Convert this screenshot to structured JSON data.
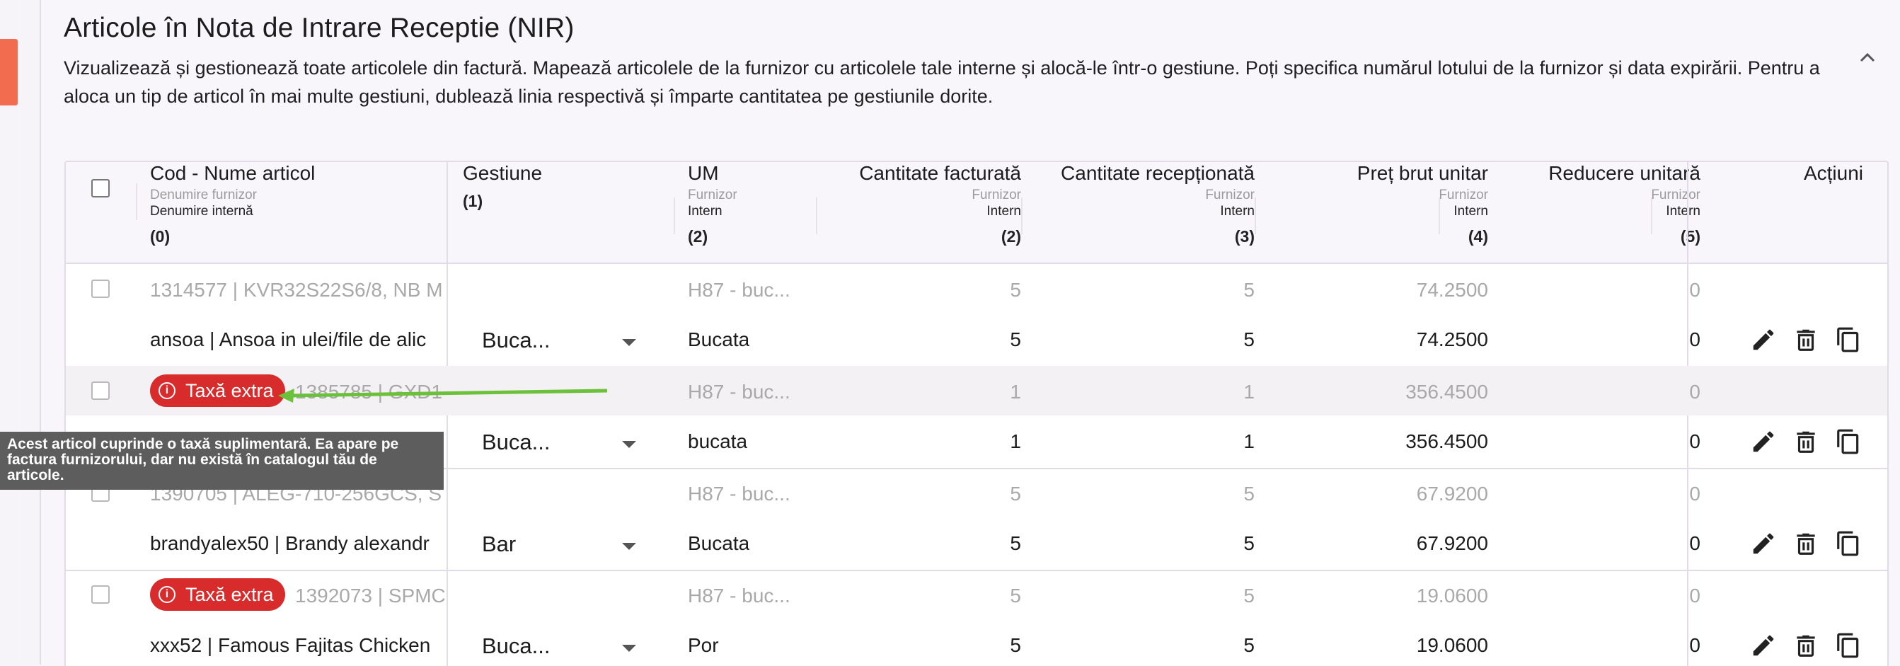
{
  "section": {
    "title": "Articole în Nota de Intrare Receptie (NIR)",
    "description": "Vizualizează și gestionează toate articolele din factură. Mapează articolele de la furnizor cu articolele tale interne și alocă-le într-o gestiune. Poți specifica numărul lotului de la furnizor și data expirării. Pentru a aloca un tip de articol în mai multe gestiuni, dublează linia respectivă și împarte cantitatea pe gestiunile dorite.",
    "collapse_icon": "chevron-up-icon"
  },
  "table": {
    "headers": {
      "name": {
        "main": "Cod - Nume articol",
        "sub1": "Denumire furnizor",
        "sub2": "Denumire internă",
        "idx": "(0)"
      },
      "gestiune": {
        "main": "Gestiune",
        "idx": "(1)"
      },
      "um": {
        "main": "UM",
        "sub1": "Furnizor",
        "sub2": "Intern",
        "idx": "(2)"
      },
      "cant_fact": {
        "main": "Cantitate facturată",
        "sub1": "Furnizor",
        "sub2": "Intern",
        "idx": "(2)"
      },
      "cant_rec": {
        "main": "Cantitate recepționată",
        "sub1": "Furnizor",
        "sub2": "Intern",
        "idx": "(3)"
      },
      "pret": {
        "main": "Preț brut unitar",
        "sub1": "Furnizor",
        "sub2": "Intern",
        "idx": "(4)"
      },
      "reducere": {
        "main": "Reducere unitară",
        "sub1": "Furnizor",
        "sub2": "Intern",
        "idx": "(5)"
      },
      "actiuni": {
        "main": "Acțiuni"
      }
    },
    "rows": [
      {
        "supplier_name": "1314577 | KVR32S22S6/8, NB M",
        "internal_name": "ansoa | Ansoa in ulei/file de alic",
        "badge": "",
        "gestiune": "Buca...",
        "um_supplier": "H87 - buc...",
        "um_internal": "Bucata",
        "cf_supplier": "5",
        "cf_internal": "5",
        "cr_supplier": "5",
        "cr_internal": "5",
        "pret_supplier": "74.2500",
        "pret_internal": "74.2500",
        "red_supplier": "0",
        "red_internal": "0"
      },
      {
        "supplier_name": "1385785 | GXD1",
        "internal_name": "",
        "badge": "Taxă extra",
        "gestiune": "Buca...",
        "um_supplier": "H87 - buc...",
        "um_internal": "bucata",
        "cf_supplier": "1",
        "cf_internal": "1",
        "cr_supplier": "1",
        "cr_internal": "1",
        "pret_supplier": "356.4500",
        "pret_internal": "356.4500",
        "red_supplier": "0",
        "red_internal": "0"
      },
      {
        "supplier_name": "1390705 | ALEG-710-256GCS, S",
        "internal_name": "brandyalex50 | Brandy alexandr",
        "badge": "",
        "gestiune": "Bar",
        "um_supplier": "H87 - buc...",
        "um_internal": "Bucata",
        "cf_supplier": "5",
        "cf_internal": "5",
        "cr_supplier": "5",
        "cr_internal": "5",
        "pret_supplier": "67.9200",
        "pret_internal": "67.9200",
        "red_supplier": "0",
        "red_internal": "0"
      },
      {
        "supplier_name": "1392073 | SPMC",
        "internal_name": "xxx52 | Famous Fajitas Chicken",
        "badge": "Taxă extra",
        "gestiune": "Buca...",
        "um_supplier": "H87 - buc...",
        "um_internal": "Por",
        "cf_supplier": "5",
        "cf_internal": "5",
        "cr_supplier": "5",
        "cr_internal": "5",
        "pret_supplier": "19.0600",
        "pret_internal": "19.0600",
        "red_supplier": "0",
        "red_internal": "0"
      }
    ],
    "action_icons": [
      "edit-icon",
      "delete-icon",
      "copy-icon"
    ]
  },
  "tooltip": {
    "text": "Acest articol cuprinde o taxă suplimentară. Ea apare pe factura furnizorului, dar nu există în catalogul tău de articole."
  },
  "colors": {
    "accent": "#f26c4f",
    "badge": "#d82c2c",
    "annotation_arrow": "#6cc13a",
    "tooltip_bg": "#5d5d5d"
  }
}
